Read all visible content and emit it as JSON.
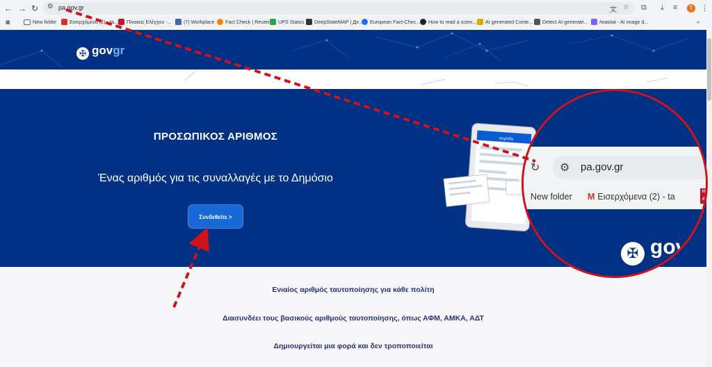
{
  "browser": {
    "url": "pa.gov.gr",
    "avatar_initial": "T",
    "bookmarks": [
      {
        "label": "New folder",
        "color": "#5f6368"
      },
      {
        "label": "Εισερχόμενα (2) - ta...",
        "color": "#d93025"
      },
      {
        "label": "Πίνακας Ελέγχου -...",
        "color": "#c8102e"
      },
      {
        "label": "(7) Workplace",
        "color": "#4267b2"
      },
      {
        "label": "Fact Check | Reuters",
        "color": "#ff8000"
      },
      {
        "label": "UPS Status",
        "color": "#2da44e"
      },
      {
        "label": "DeepStateMAP | Де...",
        "color": "#333333"
      },
      {
        "label": "European Fact-Chec...",
        "color": "#1a73e8"
      },
      {
        "label": "How to read a scien...",
        "color": "#222222"
      },
      {
        "label": "AI generated Conte...",
        "color": "#e0a800"
      },
      {
        "label": "Detect AI-generate...",
        "color": "#555555"
      },
      {
        "label": "/wasitai - AI image d...",
        "color": "#7b61ff"
      }
    ]
  },
  "site": {
    "logo_text": "gov",
    "logo_accent": "gr",
    "hero_title": "ΠΡΟΣΩΠΙΚΟΣ ΑΡΙΘΜΟΣ",
    "hero_subtitle": "Ένας αριθμός για τις συναλλαγές με το Δημόσιο",
    "login_button": "Συνδεθείτε >",
    "device_app_label": "myinfo",
    "features": [
      "Ενιαίος αριθμός ταυτοποίησης για κάθε πολίτη",
      "Διασυνδέει τους βασικούς αριθμούς ταυτοποίησης, όπως ΑΦΜ, ΑΜΚΑ, ΑΔΤ",
      "Δημιουργείται μια φορά και δεν τροποποιείται"
    ]
  },
  "zoom_callout": {
    "url": "pa.gov.gr",
    "bookmark_1": "New folder",
    "bookmark_2": "Εισερχόμενα (2) - ta",
    "badge_line1": "HO",
    "badge_line2": "AX",
    "logo_text": "gov"
  },
  "colors": {
    "primary": "#013184",
    "button": "#1769d8",
    "feature_text": "#25327a",
    "annotation": "#d0131b"
  }
}
